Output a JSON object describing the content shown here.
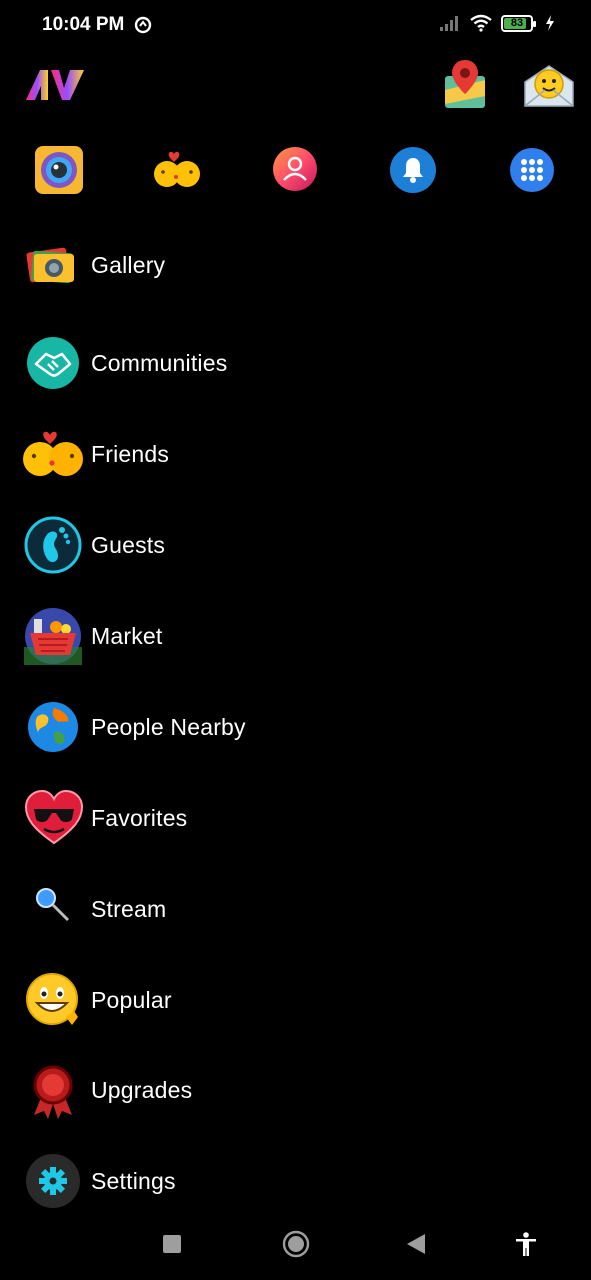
{
  "status_bar": {
    "time": "10:04 PM",
    "battery_level": "83",
    "battery_fraction": 0.83
  },
  "header": {
    "logo_icon": "app-logo-icon",
    "right_icons": [
      "map-pin-icon",
      "smiley-mail-icon"
    ]
  },
  "quick_actions": [
    {
      "icon": "camera-icon"
    },
    {
      "icon": "kissing-smileys-icon"
    },
    {
      "icon": "profile-icon"
    },
    {
      "icon": "bell-icon"
    },
    {
      "icon": "apps-grid-icon"
    }
  ],
  "menu": {
    "items": [
      {
        "label": "Gallery",
        "icon": "gallery-icon"
      },
      {
        "label": "Communities",
        "icon": "handshake-icon"
      },
      {
        "label": "Friends",
        "icon": "kissing-smileys-icon"
      },
      {
        "label": "Guests",
        "icon": "footprint-icon"
      },
      {
        "label": "Market",
        "icon": "basket-icon"
      },
      {
        "label": "People Nearby",
        "icon": "globe-icon"
      },
      {
        "label": "Favorites",
        "icon": "heart-sunglasses-icon"
      },
      {
        "label": "Stream",
        "icon": "magnifier-icon"
      },
      {
        "label": "Popular",
        "icon": "grinning-smiley-icon"
      },
      {
        "label": "Upgrades",
        "icon": "award-badge-icon"
      },
      {
        "label": "Settings",
        "icon": "gear-icon"
      }
    ]
  },
  "nav_bar": {
    "buttons": [
      "recents-button",
      "home-button",
      "back-button",
      "accessibility-button"
    ]
  },
  "colors": {
    "background": "#000000",
    "text": "#ffffff",
    "profile_gradient_start": "#ff4d6d",
    "bell_blue": "#1e7fd6",
    "apps_blue": "#2f80ed",
    "community_teal": "#18b6a4",
    "settings_cyan": "#1ec8e6"
  }
}
